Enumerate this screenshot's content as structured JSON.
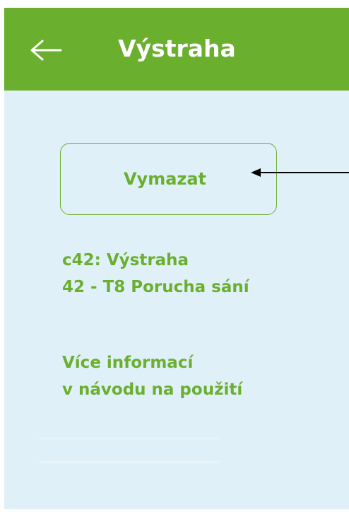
{
  "header": {
    "title": "Výstraha",
    "back_icon": "arrow-left-icon",
    "background_color": "#6aaf2e"
  },
  "actions": {
    "clear_label": "Vymazat"
  },
  "warning": {
    "code_line": "c42: Výstraha",
    "detail_line": "42 - T8  Porucha sání"
  },
  "more_info": {
    "line1": "Více informací",
    "line2": "v návodu na použití"
  },
  "colors": {
    "accent": "#6aaf2e",
    "screen_background": "#dff0f8",
    "annotation_arrow": "#000000"
  }
}
